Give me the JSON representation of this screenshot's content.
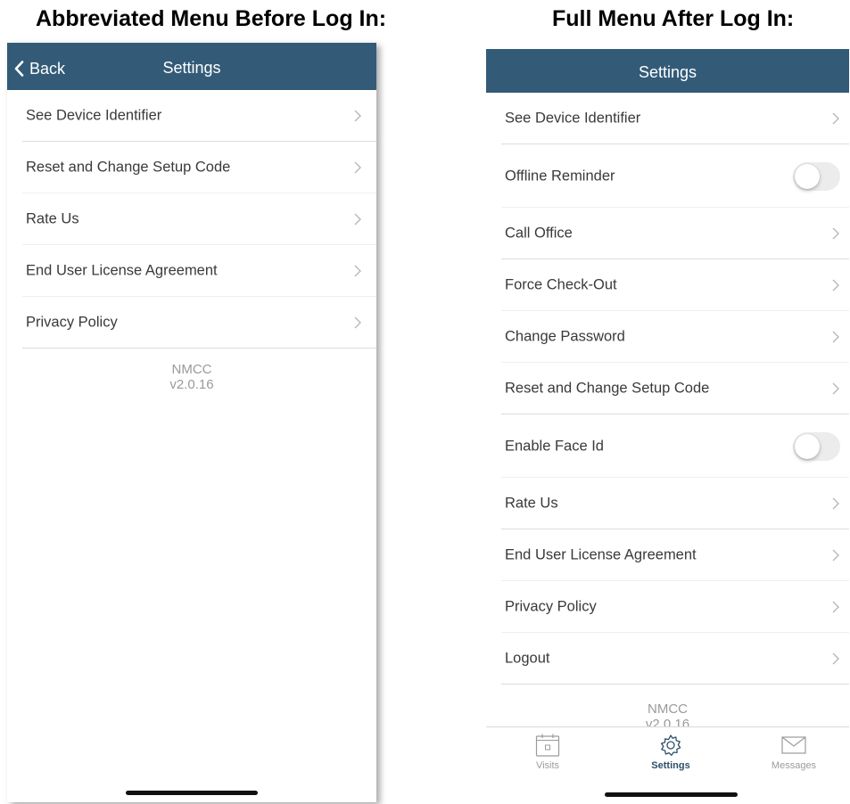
{
  "captions": {
    "left": "Abbreviated Menu Before Log In:",
    "right": "Full Menu After Log In:"
  },
  "colors": {
    "navbar": "#335b78",
    "tab_active": "#2d4f6a"
  },
  "left_screen": {
    "back_label": "Back",
    "title": "Settings",
    "items": [
      {
        "label": "See Device Identifier"
      },
      {
        "label": "Reset and Change Setup Code"
      },
      {
        "label": "Rate Us"
      },
      {
        "label": "End User License Agreement"
      },
      {
        "label": "Privacy Policy"
      }
    ],
    "app_name": "NMCC",
    "version": "v2.0.16"
  },
  "right_screen": {
    "title": "Settings",
    "items": [
      {
        "label": "See Device Identifier",
        "type": "chevron"
      },
      {
        "label": "Offline Reminder",
        "type": "toggle",
        "on": false
      },
      {
        "label": "Call Office",
        "type": "chevron"
      },
      {
        "label": "Force Check-Out",
        "type": "chevron"
      },
      {
        "label": "Change Password",
        "type": "chevron"
      },
      {
        "label": "Reset and Change Setup Code",
        "type": "chevron"
      },
      {
        "label": "Enable Face Id",
        "type": "toggle",
        "on": false
      },
      {
        "label": "Rate Us",
        "type": "chevron"
      },
      {
        "label": "End User License Agreement",
        "type": "chevron"
      },
      {
        "label": "Privacy Policy",
        "type": "chevron"
      },
      {
        "label": "Logout",
        "type": "chevron"
      }
    ],
    "app_name": "NMCC",
    "version": "v2.0.16",
    "tabs": [
      {
        "label": "Visits",
        "icon": "calendar-icon",
        "active": false
      },
      {
        "label": "Settings",
        "icon": "gear-icon",
        "active": true
      },
      {
        "label": "Messages",
        "icon": "envelope-icon",
        "active": false
      }
    ]
  }
}
